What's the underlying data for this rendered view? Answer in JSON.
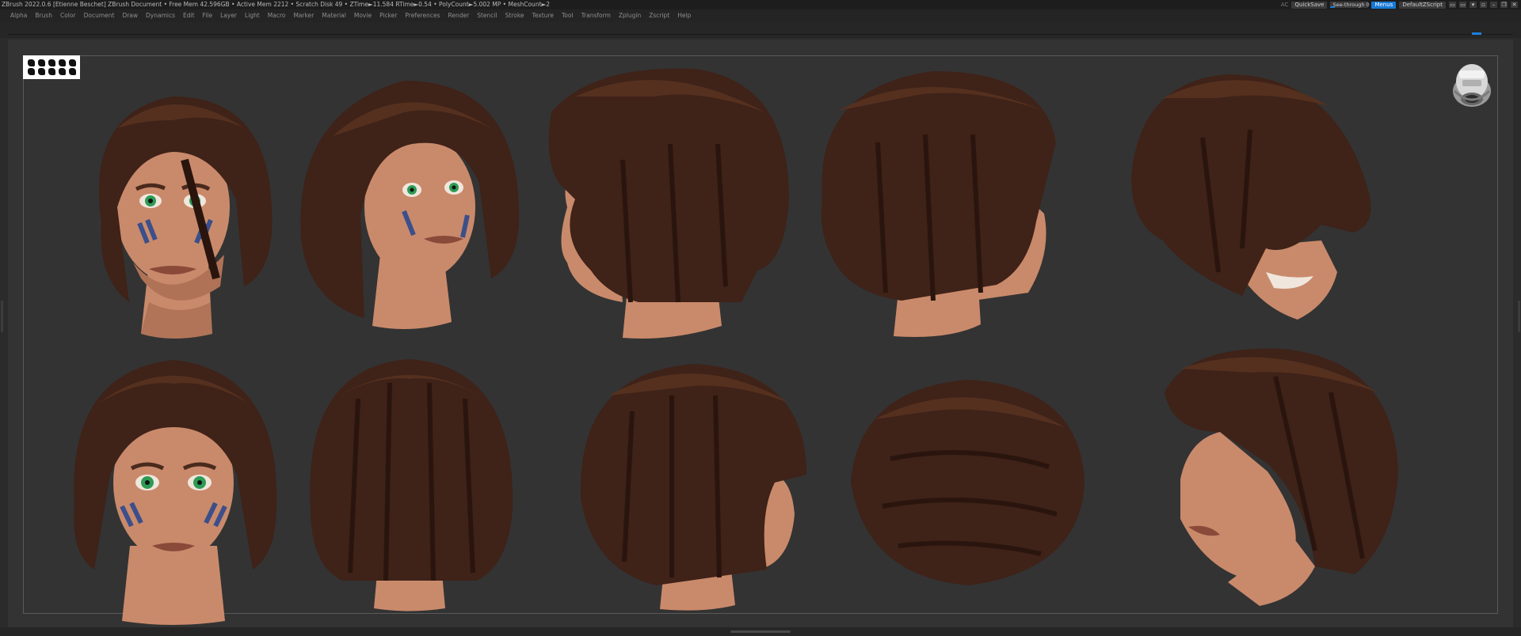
{
  "window": {
    "title": "ZBrush 2022.0.6 [Etienne Beschet]   ZBrush Document     • Free Mem 42.596GB • Active Mem 2212 • Scratch Disk 49 •  ZTime►11.584 RTime►0.54 • PolyCount►5.002 MP  • MeshCount►2",
    "ac_label": "AC",
    "quicksave_label": "QuickSave",
    "seethrough_label": "See-through  0",
    "menus_label": "Menus",
    "script_label": "DefaultZScript"
  },
  "menubar": {
    "items": [
      "Alpha",
      "Brush",
      "Color",
      "Document",
      "Draw",
      "Dynamics",
      "Edit",
      "File",
      "Layer",
      "Light",
      "Macro",
      "Marker",
      "Material",
      "Movie",
      "Picker",
      "Preferences",
      "Render",
      "Stencil",
      "Stroke",
      "Texture",
      "Tool",
      "Transform",
      "Zplugin",
      "Zscript",
      "Help"
    ]
  },
  "colors": {
    "hair": "#3f2218",
    "hair_dark": "#2a150e",
    "hair_light": "#55301f",
    "skin": "#c98a6b",
    "skin_shadow": "#9a5e45",
    "paint": "#3b4f8a",
    "eye": "#2e9b55",
    "accent": "#1778d6"
  },
  "icons": {
    "logo": "pixologic-logo-icon",
    "navigator": "navigation-gyro-icon"
  }
}
